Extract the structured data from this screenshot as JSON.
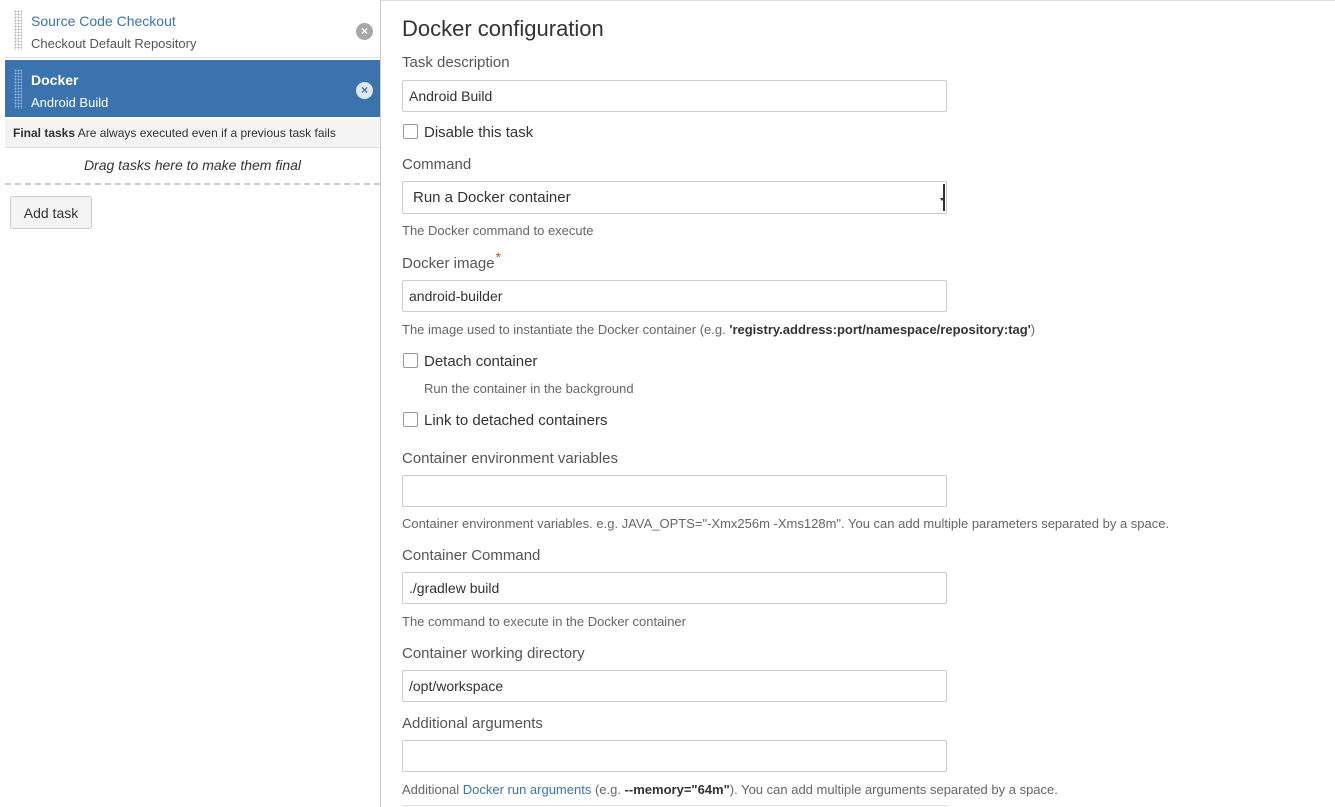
{
  "sidebar": {
    "tasks": [
      {
        "name": "Source Code Checkout",
        "subtitle": "Checkout Default Repository",
        "remove_icon": "×",
        "selected": false
      },
      {
        "name": "Docker",
        "subtitle": "Android Build",
        "remove_icon": "×",
        "selected": true
      }
    ],
    "final_tasks": {
      "title": "Final tasks",
      "description": "Are always executed even if a previous task fails",
      "drop_hint": "Drag tasks here to make them final"
    },
    "add_task_label": "Add task"
  },
  "form": {
    "title": "Docker configuration",
    "task_description": {
      "label": "Task description",
      "value": "Android Build"
    },
    "disable_task": {
      "label": "Disable this task",
      "checked": false
    },
    "command": {
      "label": "Command",
      "selected": "Run a Docker container",
      "help": "The Docker command to execute"
    },
    "docker_image": {
      "label": "Docker image",
      "required_mark": "*",
      "value": "android-builder",
      "help_prefix": "The image used to instantiate the Docker container (e.g. ",
      "help_example": "'registry.address:port/namespace/repository:tag'",
      "help_suffix": ")"
    },
    "detach_container": {
      "label": "Detach container",
      "help": "Run the container in the background",
      "checked": false
    },
    "link_containers": {
      "label": "Link to detached containers",
      "checked": false
    },
    "env_vars": {
      "label": "Container environment variables",
      "value": "",
      "help": "Container environment variables. e.g. JAVA_OPTS=\"-Xmx256m -Xms128m\". You can add multiple parameters separated by a space."
    },
    "container_command": {
      "label": "Container Command",
      "value": "./gradlew build",
      "help": "The command to execute in the Docker container"
    },
    "working_dir": {
      "label": "Container working directory",
      "value": "/opt/workspace"
    },
    "additional_args": {
      "label": "Additional arguments",
      "value": "",
      "help_prefix": "Additional ",
      "help_link": "Docker run arguments",
      "help_middle": " (e.g. ",
      "help_example": "--memory=\"64m\"",
      "help_suffix": "). You can add multiple arguments separated by a space."
    }
  },
  "colors": {
    "accent": "#3b73af",
    "selected_task_bg": "#3b73af",
    "required": "#d04437"
  }
}
